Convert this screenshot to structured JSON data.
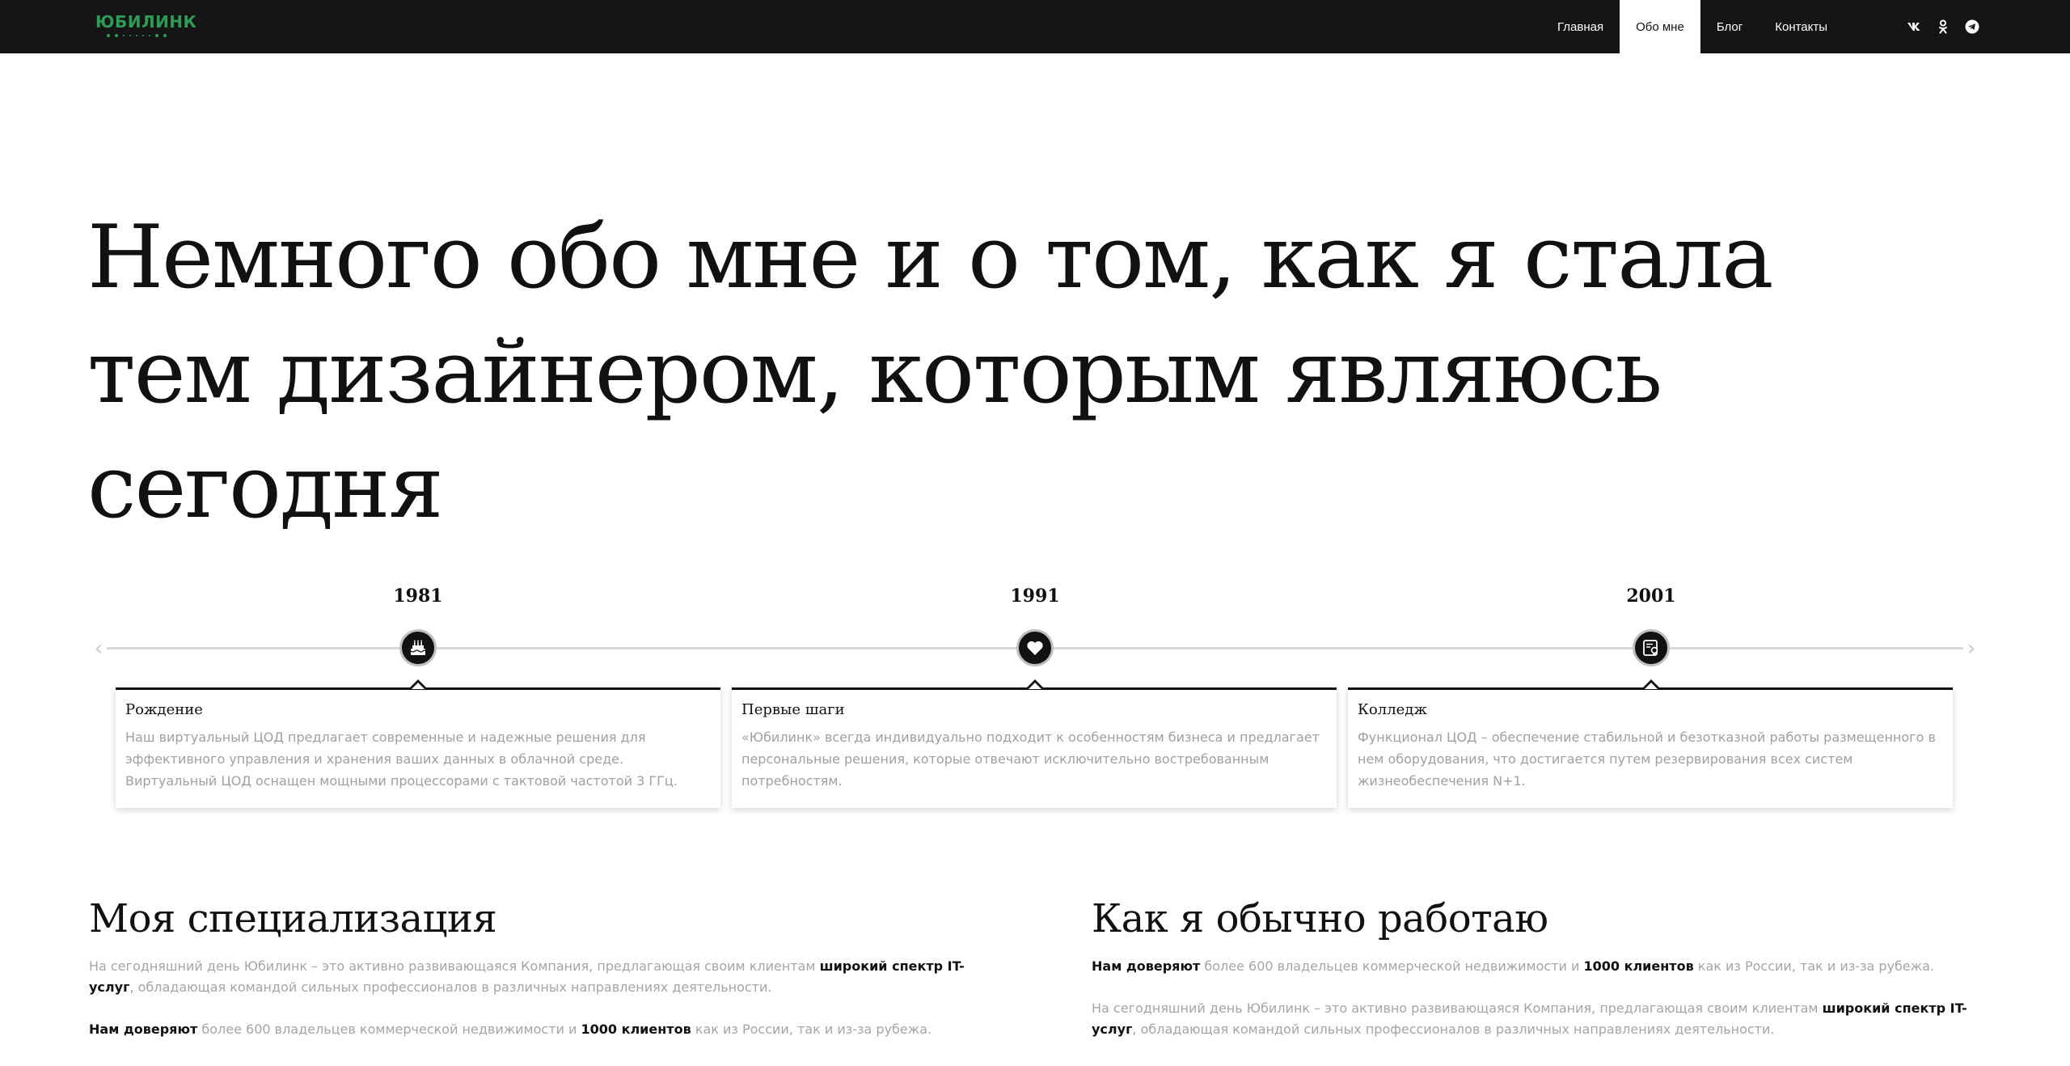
{
  "header": {
    "logo_text": "ЮБИЛИНК",
    "nav": [
      {
        "label": "Главная",
        "active": false
      },
      {
        "label": "Обо мне",
        "active": true
      },
      {
        "label": "Блог",
        "active": false
      },
      {
        "label": "Контакты",
        "active": false
      }
    ],
    "social": [
      "vk-icon",
      "odnoklassniki-icon",
      "telegram-icon"
    ]
  },
  "hero": {
    "title": "Немного обо мне и о том, как я стала тем дизайнером, которым являюсь сегодня"
  },
  "timeline": {
    "items": [
      {
        "year": "1981",
        "icon": "birthday-cake-icon",
        "title": "Рождение",
        "text": "Наш виртуальный ЦОД предлагает современные и надежные решения для эффективного управления и хранения ваших данных в облачной среде. Виртуальный ЦОД оснащен мощными процессорами с тактовой частотой 3 ГГц."
      },
      {
        "year": "1991",
        "icon": "heart-icon",
        "title": "Первые шаги",
        "text": "«Юбилинк» всегда индивидуально подходит к особенностям бизнеса и предлагает персональные решения, которые отвечают исключительно востребованным потребностям."
      },
      {
        "year": "2001",
        "icon": "certificate-icon",
        "title": "Колледж",
        "text": "Функционал ЦОД – обеспечение стабильной и безотказной работы размещенного в нем оборудования, что достигается путем резервирования всех систем жизнеобеспечения N+1."
      }
    ]
  },
  "specialization": {
    "title": "Моя специализация",
    "p1_a": "На сегодняшний день Юбилинк – это активно развивающаяся Компания, предлагающая своим клиентам ",
    "p1_b": "широкий спектр IT-услуг",
    "p1_c": ", обладающая командой сильных профессионалов в различных направлениях деятельности.",
    "p2_a": "Нам доверяют",
    "p2_b": " более 600 владельцев коммерческой недвижимости и ",
    "p2_c": "1000 клиентов",
    "p2_d": " как из России, так и из-за рубежа."
  },
  "workflow": {
    "title": "Как я обычно работаю",
    "p1_a": "Нам доверяют",
    "p1_b": " более 600 владельцев коммерческой недвижимости и ",
    "p1_c": "1000 клиентов",
    "p1_d": " как из России, так и из-за рубежа.",
    "p2_a": "На сегодняшний день Юбилинк – это активно развивающаяся Компания, предлагающая своим клиентам ",
    "p2_b": "широкий спектр IT-услуг",
    "p2_c": ", обладающая командой сильных профессионалов в различных направлениях деятельности."
  },
  "colors": {
    "header_bg": "#151515",
    "brand_green": "#2f9a55",
    "muted_text": "#a5a5a5"
  }
}
